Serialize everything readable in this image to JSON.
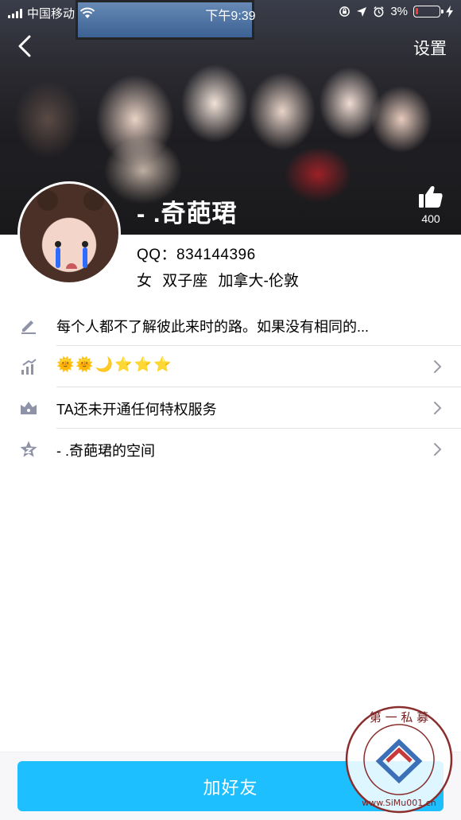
{
  "status_bar": {
    "carrier": "中国移动",
    "time": "下午9:39",
    "battery": "3%"
  },
  "nav": {
    "settings_label": "设置"
  },
  "profile": {
    "nickname": "- .奇葩珺",
    "like_count": "400",
    "qq": "QQ：834144396",
    "meta": "女  双子座  加拿大-伦敦"
  },
  "list": {
    "signature": "每个人都不了解彼此来时的路。如果没有相同的...",
    "level_icons": [
      "sun",
      "sun",
      "moon",
      "star",
      "star",
      "star"
    ],
    "privilege": "TA还未开通任何特权服务",
    "space": "- .奇葩珺的空间"
  },
  "actions": {
    "add_friend": "加好友"
  },
  "watermark": {
    "text": "第一私募 www.SiMu001.cn"
  },
  "colors": {
    "accent": "#1dbfff",
    "icon": "#8e93a8",
    "separator": "#e3e3e6"
  }
}
